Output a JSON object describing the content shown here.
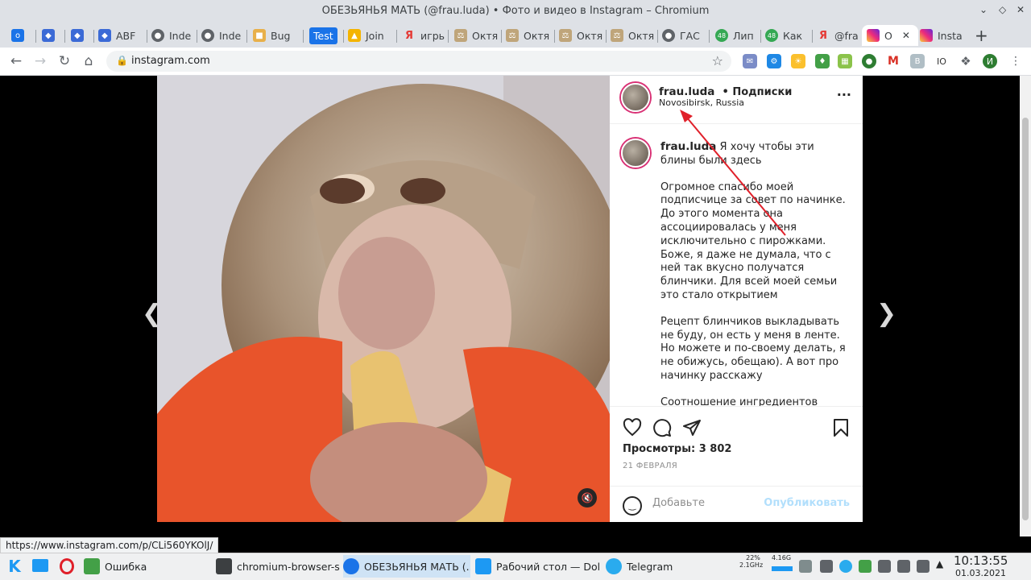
{
  "window": {
    "title": "ОБЕЗЬЯНЬЯ МАТЬ (@frau.luda) • Фото и видео в Instagram – Chromium"
  },
  "tabs": [
    {
      "label": "o",
      "favicon": "globe"
    },
    {
      "label": "",
      "favicon": "cube-icon"
    },
    {
      "label": "",
      "favicon": "cube-icon"
    },
    {
      "label": "ABF",
      "favicon": "cube-icon"
    },
    {
      "label": "Inde",
      "favicon": "globe"
    },
    {
      "label": "Inde",
      "favicon": "globe"
    },
    {
      "label": "Bug",
      "favicon": "bug"
    },
    {
      "label": "Test",
      "favicon": "none"
    },
    {
      "label": "Join",
      "favicon": "construction"
    },
    {
      "label": "игры",
      "favicon": "yandex"
    },
    {
      "label": "Октя",
      "favicon": "scales"
    },
    {
      "label": "Октя",
      "favicon": "scales"
    },
    {
      "label": "Октя",
      "favicon": "scales"
    },
    {
      "label": "Октя",
      "favicon": "scales"
    },
    {
      "label": "ГАС",
      "favicon": "globe"
    },
    {
      "label": "Лип",
      "favicon": "48"
    },
    {
      "label": "Как",
      "favicon": "48"
    },
    {
      "label": "@fra",
      "favicon": "yandex"
    },
    {
      "label": "О",
      "favicon": "instagram"
    },
    {
      "label": "Insta",
      "favicon": "instagram"
    }
  ],
  "omnibox": {
    "url": "instagram.com"
  },
  "colors": {
    "instagram_blue": "#0095f6",
    "ring": "#d93175",
    "tab_bg": "#dee1e6"
  },
  "post": {
    "username": "frau.luda",
    "follow_state": "• Подписки",
    "location": "Novosibirsk, Russia",
    "caption_user": "frau.luda",
    "caption_first": "Я хочу чтобы эти блины были здесь",
    "paragraphs": [
      "Огромное спасибо моей подписчице за совет по начинке. До этого момента она ассоциировалась у меня исключительно с пирожками. Боже, я даже не думала, что с ней так вкусно получатся блинчики. Для всей моей семьи это стало открытием",
      "Рецепт блинчиков выкладывать не буду, он есть у меня в ленте. Но можете и по-своему делать, я не обижусь, обещаю). А вот про начинку расскажу",
      "Соотношение ингредиентов напишу такое, как было у меня. Но Вы"
    ],
    "views": "Просмотры: 3 802",
    "date": "21 ФЕВРАЛЯ",
    "comment_placeholder": "Добавьте",
    "publish": "Опубликовать",
    "more": "···"
  },
  "status_url": "https://www.instagram.com/p/CLi560YKOlJ/",
  "taskbar": {
    "items": [
      {
        "label": "Ошибка"
      },
      {
        "label": "chromium-browser-s..."
      },
      {
        "label": "ОБЕЗЬЯНЬЯ МАТЬ (..."
      },
      {
        "label": "Рабочий стол — Dol..."
      },
      {
        "label": "Telegram"
      }
    ],
    "cpu": "22%",
    "cpu_freq": "2.1GHz",
    "mem": "4.16G",
    "time": "10:13:55",
    "date": "01.03.2021"
  },
  "profile_initial": "И"
}
